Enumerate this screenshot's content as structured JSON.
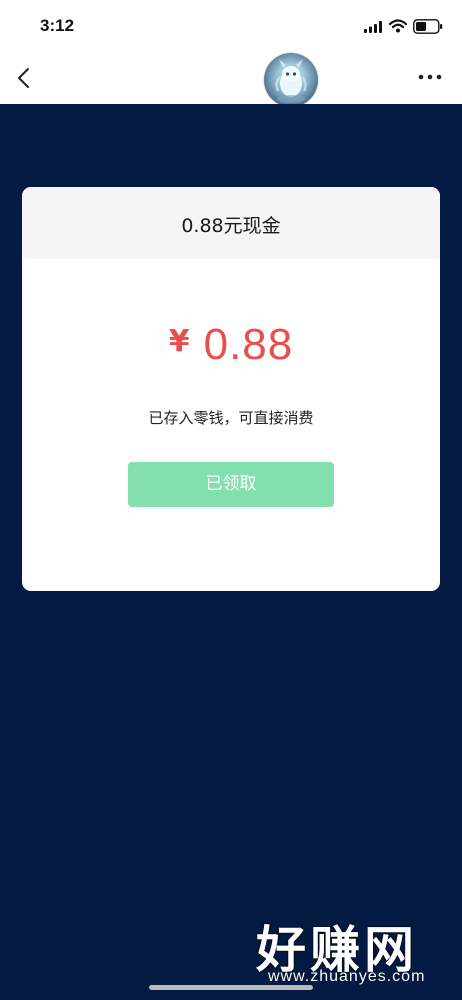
{
  "status_bar": {
    "time": "3:12"
  },
  "nav": {
    "back_icon": "chevron-left-icon",
    "more_icon": "more-horizontal-icon",
    "avatar": "dragon-avatar"
  },
  "card": {
    "title": "0.88元现金",
    "currency_symbol": "¥",
    "amount": "0.88",
    "note": "已存入零钱，可直接消费",
    "button_label": "已领取"
  },
  "watermark": {
    "text": "好赚网",
    "url": "www.zhuanyes.com"
  },
  "colors": {
    "background": "#031b43",
    "amount": "#e7504d",
    "button": "#82dfae"
  }
}
